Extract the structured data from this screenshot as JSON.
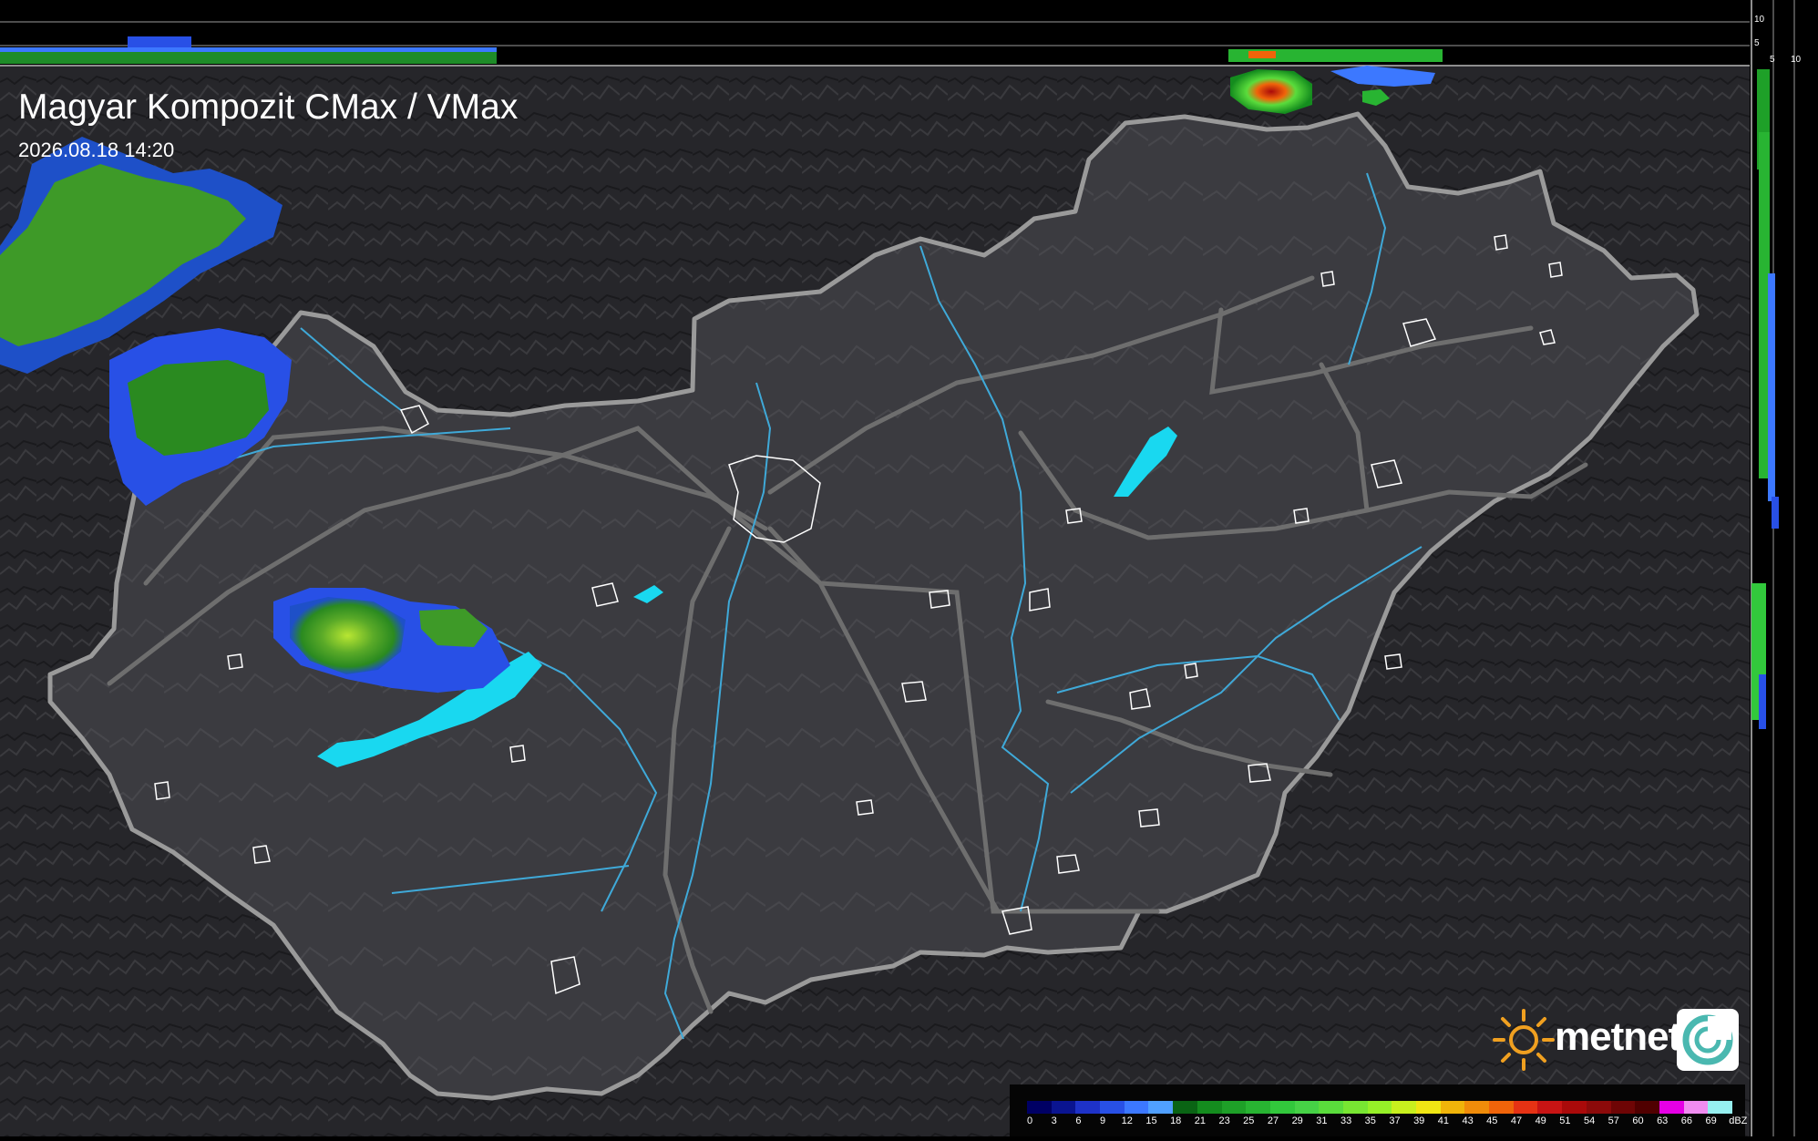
{
  "map": {
    "title": "Magyar Kompozit CMax / VMax",
    "timestamp": "2026.08.18 14:20"
  },
  "profile_scales": {
    "top_ticks": [
      "10",
      "5"
    ],
    "side_ticks": [
      "5",
      "10"
    ]
  },
  "legend": {
    "unit": "dBZ",
    "ticks": [
      "0",
      "3",
      "6",
      "9",
      "12",
      "15",
      "18",
      "21",
      "23",
      "25",
      "27",
      "29",
      "31",
      "33",
      "35",
      "37",
      "39",
      "41",
      "43",
      "45",
      "47",
      "49",
      "51",
      "54",
      "57",
      "60",
      "63",
      "66",
      "69"
    ],
    "colors": [
      "#000064",
      "#0a1490",
      "#1e32c8",
      "#2850e6",
      "#3c78ff",
      "#50a0ff",
      "#0a6414",
      "#148c1e",
      "#1ea028",
      "#28b432",
      "#32c83c",
      "#46d246",
      "#5adc3c",
      "#78e632",
      "#96f028",
      "#c8f01e",
      "#f0e614",
      "#f0b40a",
      "#f08c0a",
      "#f0640a",
      "#e63214",
      "#c81414",
      "#aa0a0a",
      "#8c0a0a",
      "#6e0505",
      "#500000",
      "#e600e6",
      "#f08cf0",
      "#96f0f0"
    ]
  },
  "logo": {
    "name": "metnet",
    "colors": {
      "sun": "#f0a020",
      "text": "#ffffff",
      "mark": "#4ab8b0"
    }
  },
  "colors": {
    "country_border": "#9a9a9a",
    "rivers": "#3fa9d8",
    "roads": "#6e6e6e",
    "lakes": "#19d8f0",
    "towns": "#ffffff",
    "terrain": "#2a2a2e"
  }
}
